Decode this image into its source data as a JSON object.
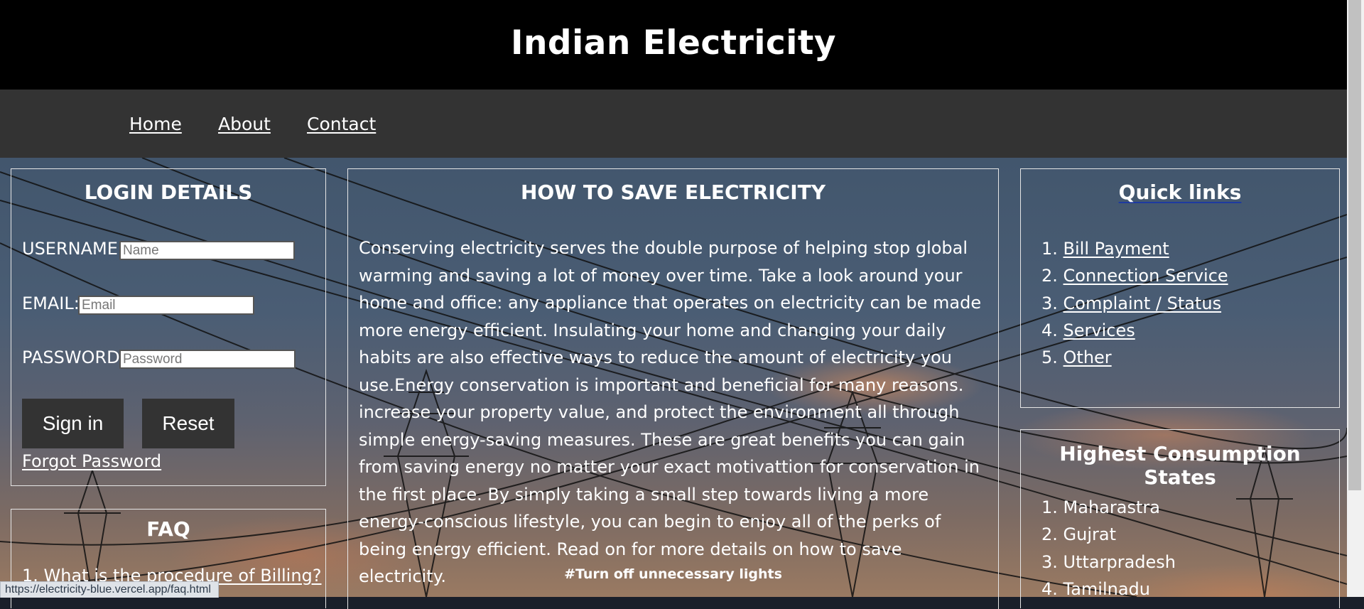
{
  "header": {
    "title": "Indian Electricity"
  },
  "nav": [
    {
      "label": "Home"
    },
    {
      "label": "About"
    },
    {
      "label": "Contact"
    }
  ],
  "login": {
    "title": "LOGIN DETAILS",
    "username_label": "USERNAME:",
    "username_placeholder": "Name",
    "email_label": "EMAIL:",
    "email_placeholder": "Email",
    "password_label": "PASSWORD:",
    "password_placeholder": "Password",
    "signin_label": "Sign in",
    "reset_label": "Reset",
    "forgot_label": "Forgot Password"
  },
  "faq": {
    "title": "FAQ",
    "items": [
      {
        "label": "What is the procedure of Billing?"
      }
    ]
  },
  "main": {
    "title": "HOW TO SAVE ELECTRICITY",
    "paragraph": "Conserving electricity serves the double purpose of helping stop global warming and saving a lot of money over time. Take a look around your home and office: any appliance that operates on electricity can be made more energy efficient. Insulating your home and changing your daily habits are also effective ways to reduce the amount of electricity you use.Energy conservation is important and beneficial for many reasons. increase your property value, and protect the environment all through simple energy-saving measures. These are great benefits you can gain from saving energy no matter your exact motivattion for conservation in the first place. By simply taking a small step towards living a more energy-conscious lifestyle, you can begin to enjoy all of the perks of being energy efficient. Read on for more details on how to save electricity.",
    "tip": "#Turn off unnecessary lights"
  },
  "quick_links": {
    "title": "Quick links",
    "items": [
      {
        "label": "Bill Payment"
      },
      {
        "label": "Connection Service"
      },
      {
        "label": "Complaint / Status"
      },
      {
        "label": "Services"
      },
      {
        "label": "Other"
      }
    ]
  },
  "states": {
    "title": "Highest Consumption States",
    "items": [
      "Maharastra",
      "Gujrat",
      "Uttarpradesh",
      "Tamilnadu"
    ]
  },
  "status_bar": {
    "url": "https://electricity-blue.vercel.app/faq.html"
  }
}
